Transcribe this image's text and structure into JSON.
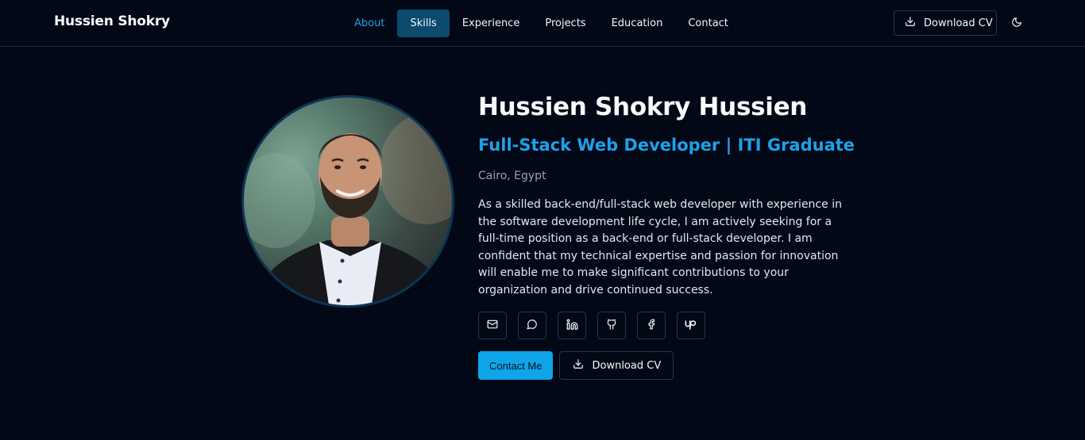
{
  "header": {
    "brand": "Hussien Shokry",
    "nav": [
      {
        "label": "About"
      },
      {
        "label": "Skills"
      },
      {
        "label": "Experience"
      },
      {
        "label": "Projects"
      },
      {
        "label": "Education"
      },
      {
        "label": "Contact"
      }
    ],
    "active_nav": "About",
    "highlighted_nav": "Skills",
    "download_cv": "Download CV",
    "theme_icon": "moon-icon"
  },
  "hero": {
    "photo_alt": "Hussien Shokry Hussien",
    "name": "Hussien Shokry Hussien",
    "role": "Full-Stack Web Developer | ITI Graduate",
    "location": "Cairo, Egypt",
    "bio": "As a skilled back-end/full-stack web developer with experience in the software development life cycle, I am actively seeking for a full-time position as a back-end or full-stack developer. I am confident that my technical expertise and passion for innovation will enable me to make significant contributions to your organization and drive continued success.",
    "socials": [
      "mail-icon",
      "chat-icon",
      "linkedin-icon",
      "github-icon",
      "facebook-icon",
      "upwork-icon"
    ],
    "contact_button": "Contact Me",
    "download_cv": "Download CV"
  },
  "colors": {
    "background": "#030817",
    "accent": "#1ea1e8",
    "primary_button": "#0ea5e9",
    "nav_highlight": "#0c4a6e"
  }
}
